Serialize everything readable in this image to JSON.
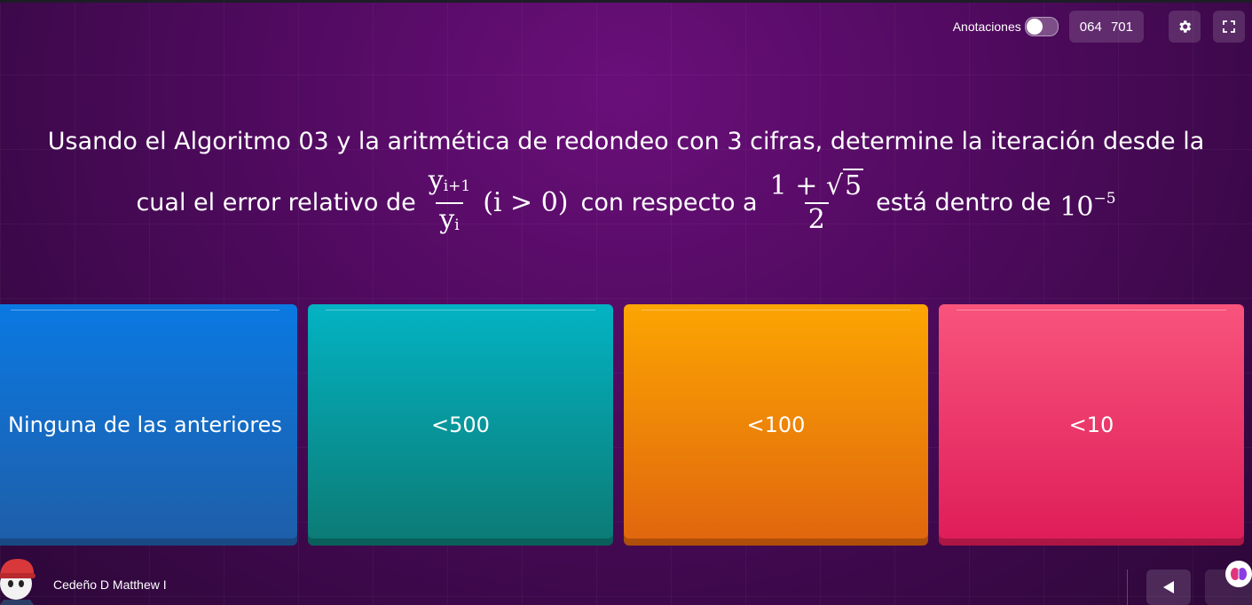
{
  "header": {
    "annotations_label": "Anotaciones",
    "annotations_on": false,
    "game_code": "064 701",
    "settings_icon": "gear-icon",
    "fullscreen_icon": "fullscreen-icon"
  },
  "question": {
    "line1": "Usando el Algoritmo 03 y la aritmética de redondeo con 3 cifras, determine la iteración desde la",
    "part_a": "cual el error relativo de",
    "frac1_num": "y",
    "frac1_num_sub": "i+1",
    "frac1_den": "y",
    "frac1_den_sub": "i",
    "condition": "(i > 0)",
    "part_b": "con respecto a",
    "frac2_num_a": "1 + ",
    "frac2_num_sqrt": "5",
    "frac2_den": "2",
    "part_c": "está dentro de",
    "power_base": "10",
    "power_exp": "−5"
  },
  "answers": [
    {
      "label": "Ninguna de las anteriores",
      "color": "#0a79e2"
    },
    {
      "label": "<500",
      "color": "#03b3c3"
    },
    {
      "label": "<100",
      "color": "#fca502"
    },
    {
      "label": "<10",
      "color": "#f8547c"
    }
  ],
  "footer": {
    "username": "Cedeño D Matthew I",
    "prev_icon": "triangle-left-icon",
    "assistant_icon": "brain-icon"
  }
}
